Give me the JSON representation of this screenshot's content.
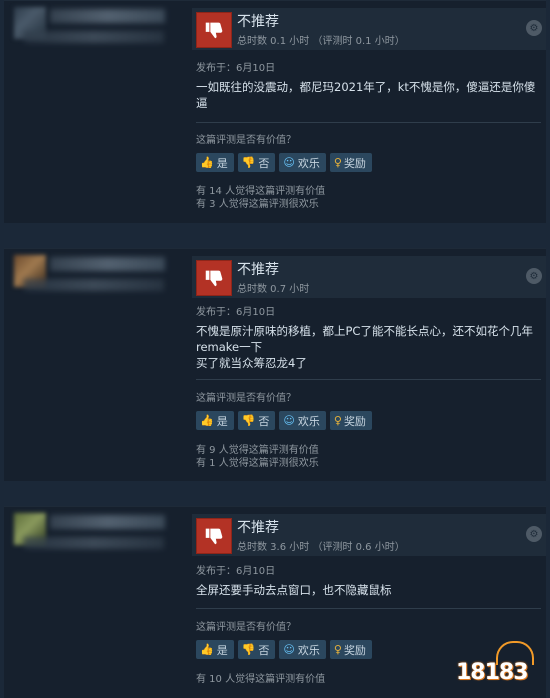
{
  "colors": {
    "thumb_down": "#b33225",
    "accent": "#67c1f5",
    "award": "#e8b23a"
  },
  "reviews": [
    {
      "verdict": "不推荐",
      "hours": "总时数 0.1 小时 （评测时 0.1 小时）",
      "posted": "发布于：6月10日",
      "body_lines": [
        "一如既往的没震动，都尼玛2021年了，kt不愧是你，傻逼还是你傻",
        "逼"
      ],
      "helpful_question": "这篇评测是否有价值？",
      "yes": "是",
      "no": "否",
      "funny": "欢乐",
      "award": "奖励",
      "votes": [
        "有 14 人觉得这篇评测有价值",
        "有 3 人觉得这篇评测很欢乐"
      ]
    },
    {
      "verdict": "不推荐",
      "hours": "总时数 0.7 小时",
      "posted": "发布于：6月10日",
      "body_lines": [
        "不愧是原汁原味的移植，都上PC了能不能长点心，还不如花个几年",
        "remake一下",
        "买了就当众筹忍龙4了"
      ],
      "helpful_question": "这篇评测是否有价值？",
      "yes": "是",
      "no": "否",
      "funny": "欢乐",
      "award": "奖励",
      "votes": [
        "有 9 人觉得这篇评测有价值",
        "有 1 人觉得这篇评测很欢乐"
      ]
    },
    {
      "verdict": "不推荐",
      "hours": "总时数 3.6 小时 （评测时 0.6 小时）",
      "posted": "发布于：6月10日",
      "body_lines": [
        "全屏还要手动去点窗口，也不隐藏鼠标"
      ],
      "helpful_question": "这篇评测是否有价值？",
      "yes": "是",
      "no": "否",
      "funny": "欢乐",
      "award": "奖励",
      "votes": [
        "有 10 人觉得这篇评测有价值"
      ]
    }
  ],
  "watermark": {
    "text": "18183"
  }
}
